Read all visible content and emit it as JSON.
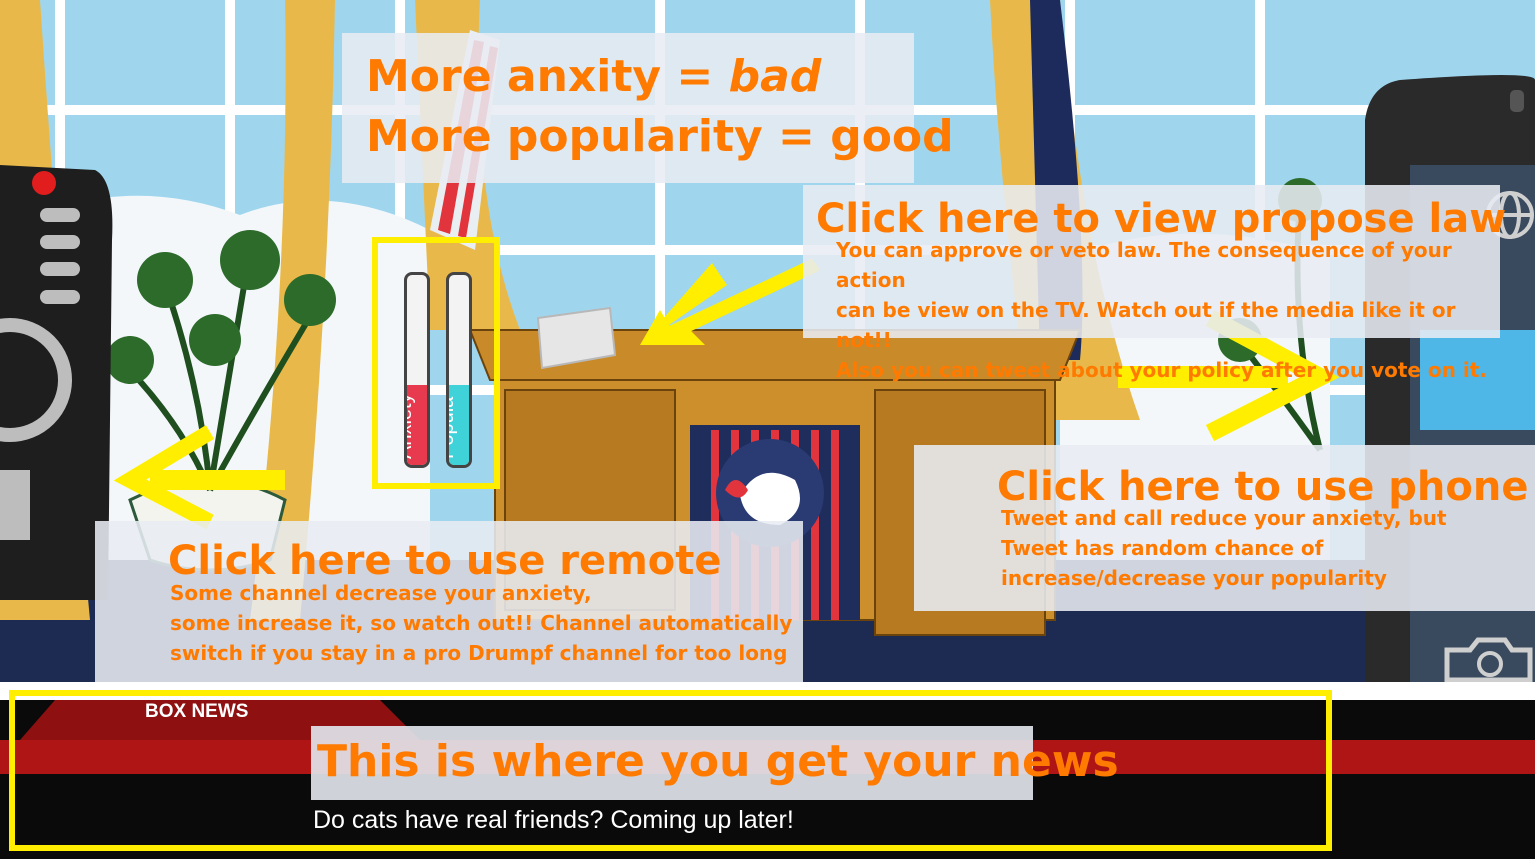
{
  "rules": {
    "line1_prefix": "More anxity = ",
    "line1_emphasis": "bad",
    "line2_prefix": "More popularity = ",
    "line2_emphasis": "good"
  },
  "law_hint": {
    "title": "Click here to view propose law",
    "description": "You can approve or veto law. The consequence of your action\ncan be view on the TV. Watch out if the media like it or not!!\nAlso you can tweet about your policy after you vote on it."
  },
  "phone_hint": {
    "title": "Click here to use phone",
    "description": "Tweet and call reduce your anxiety, but\nTweet has random chance of\nincrease/decrease your popularity"
  },
  "remote_hint": {
    "title": "Click here to use remote",
    "description": "Some channel decrease your anxiety,\nsome increase it, so watch out!! Channel automatically\nswitch if you stay in a pro Drumpf channel for too long"
  },
  "meters": {
    "anxiety": {
      "label": "Anxiety",
      "level": 0.42,
      "color": "#e83a4f"
    },
    "popularity": {
      "label": "Popula",
      "level": 0.42,
      "color": "#3fd2d9"
    }
  },
  "news": {
    "channel_name": "BOX NEWS",
    "hint": "This is where you get your news",
    "ticker": "Do cats have real friends? Coming up later!"
  },
  "colors": {
    "hint_text": "#ff7a00",
    "highlight": "#ffee00"
  }
}
